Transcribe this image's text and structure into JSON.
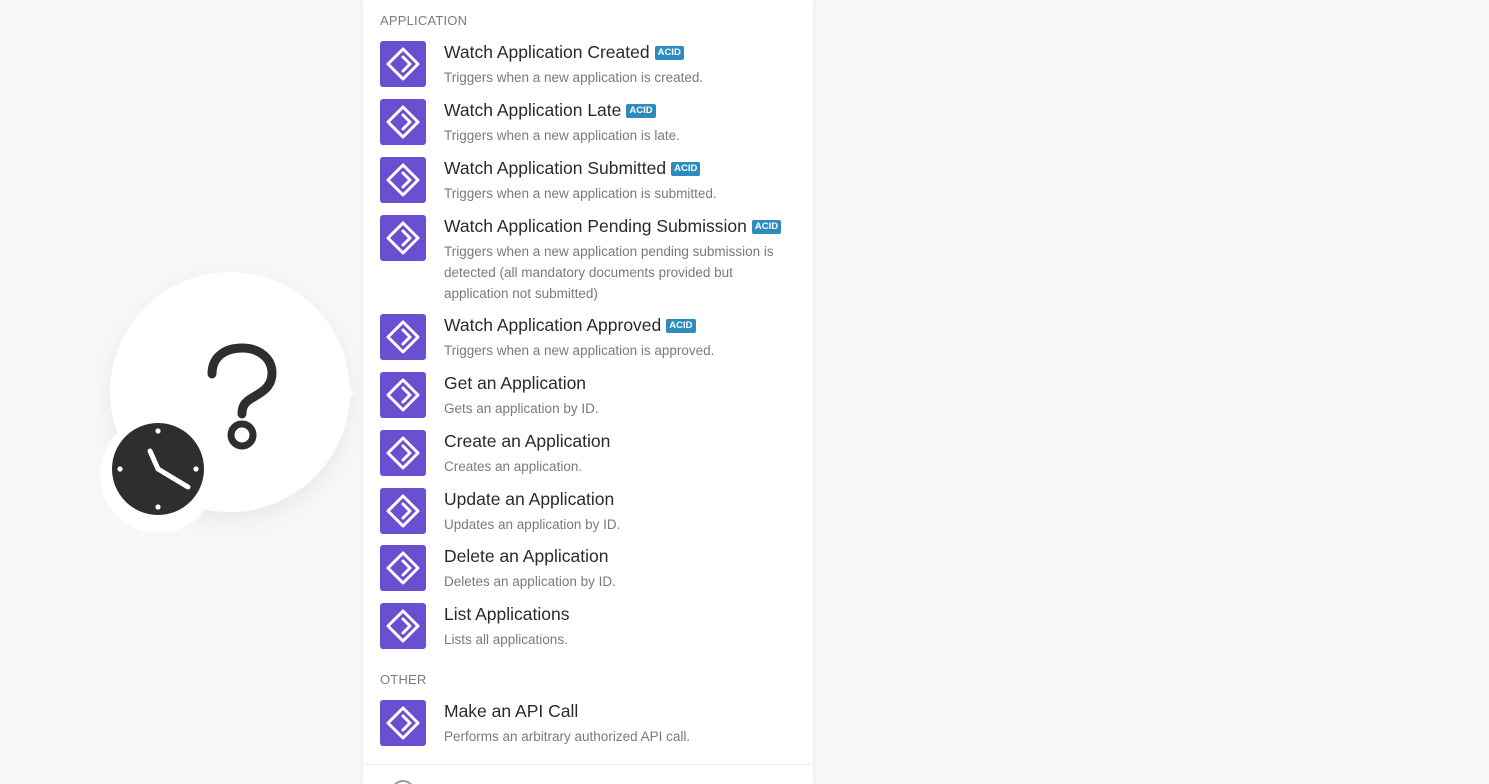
{
  "sections": [
    {
      "header": "APPLICATION",
      "items": [
        {
          "title": "Watch Application Created",
          "badge": "ACID",
          "description": "Triggers when a new application is created."
        },
        {
          "title": "Watch Application Late",
          "badge": "ACID",
          "description": "Triggers when a new application is late."
        },
        {
          "title": "Watch Application Submitted",
          "badge": "ACID",
          "description": "Triggers when a new application is submitted."
        },
        {
          "title": "Watch Application Pending Submission",
          "badge": "ACID",
          "description": "Triggers when a new application pending submission is detected (all mandatory documents provided but application not submitted)"
        },
        {
          "title": "Watch Application Approved",
          "badge": "ACID",
          "description": "Triggers when a new application is approved."
        },
        {
          "title": "Get an Application",
          "badge": "",
          "description": "Gets an application by ID."
        },
        {
          "title": "Create an Application",
          "badge": "",
          "description": "Creates an application."
        },
        {
          "title": "Update an Application",
          "badge": "",
          "description": "Updates an application by ID."
        },
        {
          "title": "Delete an Application",
          "badge": "",
          "description": "Deletes an application by ID."
        },
        {
          "title": "List Applications",
          "badge": "",
          "description": "Lists all applications."
        }
      ]
    },
    {
      "header": "OTHER",
      "items": [
        {
          "title": "Make an API Call",
          "badge": "",
          "description": "Performs an arbitrary authorized API call."
        }
      ]
    }
  ],
  "colors": {
    "app_icon_bg": "#6a4fd0",
    "badge_bg": "#2d8bbd",
    "clock_face": "#2e2e2e"
  },
  "icons": {
    "module": "question-mark-icon",
    "trigger": "clock-icon",
    "app": "diamond-icon"
  }
}
